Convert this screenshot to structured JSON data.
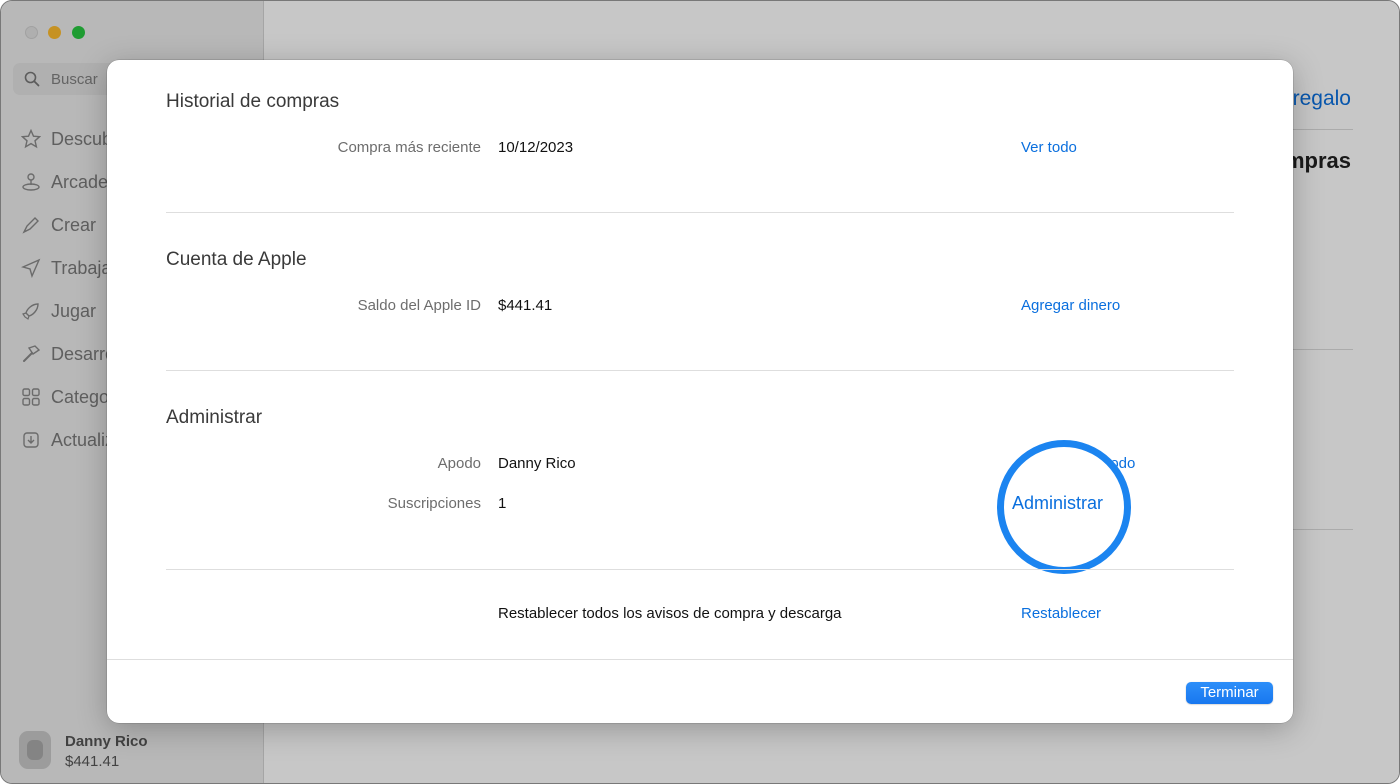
{
  "sidebar": {
    "search_label": "Buscar",
    "items": [
      {
        "label": "Descubrir",
        "icon": "star-icon"
      },
      {
        "label": "Arcade",
        "icon": "joystick-icon"
      },
      {
        "label": "Crear",
        "icon": "brush-icon"
      },
      {
        "label": "Trabajar",
        "icon": "paper-plane-icon"
      },
      {
        "label": "Jugar",
        "icon": "rocket-icon"
      },
      {
        "label": "Desarrollar",
        "icon": "hammer-icon"
      },
      {
        "label": "Categorías",
        "icon": "grid-icon"
      },
      {
        "label": "Actualizaciones",
        "icon": "download-icon"
      }
    ],
    "account": {
      "name": "Danny Rico",
      "balance": "$441.41"
    }
  },
  "background": {
    "link_partial": "regalo",
    "title_partial": "mpras"
  },
  "dialog": {
    "sections": [
      {
        "title": "Historial de compras",
        "rows": [
          {
            "label": "Compra más reciente",
            "value": "10/12/2023",
            "action": "Ver todo"
          }
        ]
      },
      {
        "title": "Cuenta de Apple",
        "rows": [
          {
            "label": "Saldo del Apple ID",
            "value": "$441.41",
            "action": "Agregar dinero"
          }
        ]
      },
      {
        "title": "Administrar",
        "rows": [
          {
            "label": "Apodo",
            "value": "Danny Rico",
            "action": "podo"
          },
          {
            "label": "Suscripciones",
            "value": "1",
            "action": "Administrar"
          }
        ]
      }
    ],
    "reset": {
      "text": "Restablecer todos los avisos de compra y descarga",
      "action": "Restablecer"
    },
    "done_label": "Terminar"
  },
  "colors": {
    "accent": "#0a6fde",
    "ring": "#1b84f0",
    "button": "#1877ef"
  }
}
